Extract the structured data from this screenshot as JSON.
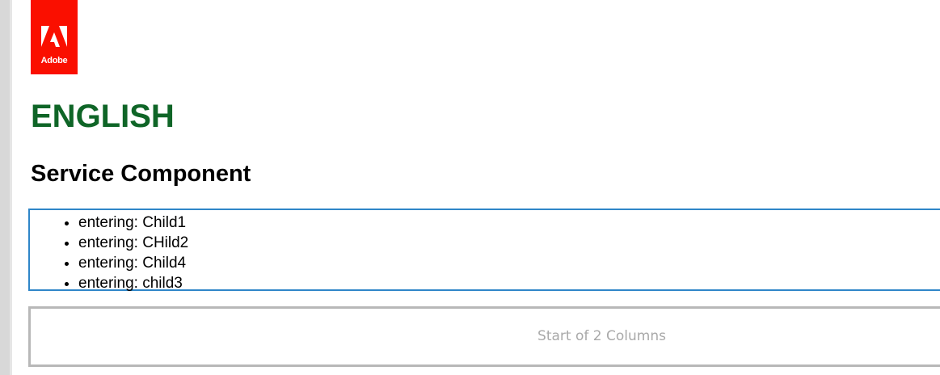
{
  "logo": {
    "text": "Adobe",
    "color": "#fa0f00"
  },
  "language_title": "ENGLISH",
  "section_title": "Service Component",
  "service_items": [
    "entering: Child1",
    "entering: CHild2",
    "entering: Child4",
    "entering: child3"
  ],
  "columns_placeholder": "Start of 2 Columns",
  "colors": {
    "title_green": "#0f6527",
    "selection_blue": "#2f86c8",
    "placeholder_border": "#b8b8b8"
  }
}
